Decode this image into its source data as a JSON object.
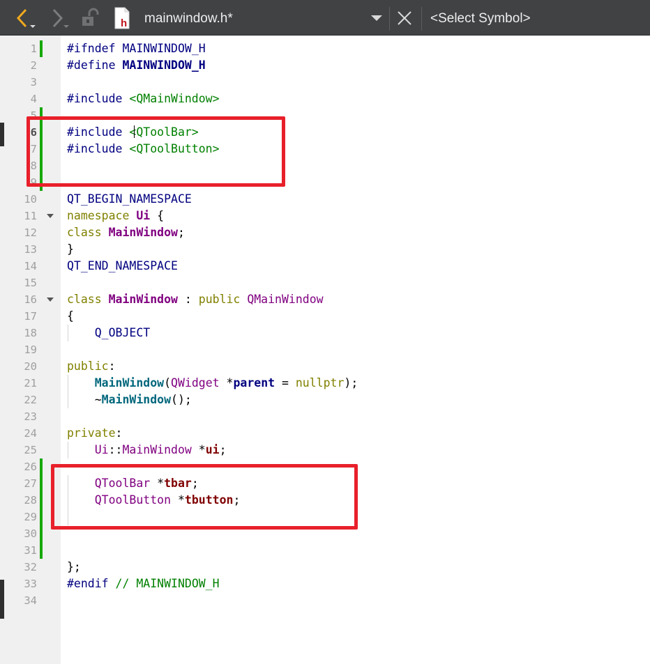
{
  "toolbar": {
    "file_name": "mainwindow.h*",
    "symbol_selector": "<Select Symbol>"
  },
  "editor": {
    "current_line": 6,
    "lines": [
      {
        "n": "1",
        "tokens": [
          [
            "pp",
            "#ifndef "
          ],
          [
            "mac",
            "MAINWINDOW_H"
          ]
        ]
      },
      {
        "n": "2",
        "tokens": [
          [
            "pp",
            "#define "
          ],
          [
            "param",
            "MAINWINDOW_H"
          ]
        ]
      },
      {
        "n": "3",
        "tokens": []
      },
      {
        "n": "4",
        "tokens": [
          [
            "pp",
            "#include "
          ],
          [
            "inc",
            "<QMainWindow>"
          ]
        ]
      },
      {
        "n": "5",
        "tokens": []
      },
      {
        "n": "6",
        "tokens": [
          [
            "pp",
            "#include "
          ],
          [
            "inc",
            "<QToolBar>"
          ]
        ]
      },
      {
        "n": "7",
        "tokens": [
          [
            "pp",
            "#include "
          ],
          [
            "inc",
            "<QToolButton>"
          ]
        ]
      },
      {
        "n": "8",
        "tokens": []
      },
      {
        "n": "9",
        "tokens": []
      },
      {
        "n": "10",
        "tokens": [
          [
            "mac",
            "QT_BEGIN_NAMESPACE"
          ]
        ]
      },
      {
        "n": "11",
        "fold": true,
        "tokens": [
          [
            "kw",
            "namespace "
          ],
          [
            "typeb",
            "Ui"
          ],
          [
            "plain",
            " {"
          ]
        ]
      },
      {
        "n": "12",
        "tokens": [
          [
            "kw",
            "class "
          ],
          [
            "typeb",
            "MainWindow"
          ],
          [
            "plain",
            ";"
          ]
        ]
      },
      {
        "n": "13",
        "tokens": [
          [
            "plain",
            "}"
          ]
        ]
      },
      {
        "n": "14",
        "tokens": [
          [
            "mac",
            "QT_END_NAMESPACE"
          ]
        ]
      },
      {
        "n": "15",
        "tokens": []
      },
      {
        "n": "16",
        "fold": true,
        "tokens": [
          [
            "kw",
            "class "
          ],
          [
            "typeb",
            "MainWindow"
          ],
          [
            "plain",
            " : "
          ],
          [
            "kw",
            "public "
          ],
          [
            "type",
            "QMainWindow"
          ]
        ]
      },
      {
        "n": "17",
        "tokens": [
          [
            "plain",
            "{"
          ]
        ]
      },
      {
        "n": "18",
        "tokens": [
          [
            "plain",
            "    "
          ],
          [
            "mac",
            "Q_OBJECT"
          ]
        ]
      },
      {
        "n": "19",
        "tokens": []
      },
      {
        "n": "20",
        "tokens": [
          [
            "kw",
            "public"
          ],
          [
            "plain",
            ":"
          ]
        ]
      },
      {
        "n": "21",
        "tokens": [
          [
            "plain",
            "    "
          ],
          [
            "fn",
            "MainWindow"
          ],
          [
            "plain",
            "("
          ],
          [
            "type",
            "QWidget"
          ],
          [
            "plain",
            " *"
          ],
          [
            "param",
            "parent"
          ],
          [
            "plain",
            " = "
          ],
          [
            "kw",
            "nullptr"
          ],
          [
            "plain",
            ");"
          ]
        ]
      },
      {
        "n": "22",
        "tokens": [
          [
            "plain",
            "    ~"
          ],
          [
            "fn",
            "MainWindow"
          ],
          [
            "plain",
            "();"
          ]
        ]
      },
      {
        "n": "23",
        "tokens": []
      },
      {
        "n": "24",
        "tokens": [
          [
            "kw",
            "private"
          ],
          [
            "plain",
            ":"
          ]
        ]
      },
      {
        "n": "25",
        "tokens": [
          [
            "plain",
            "    "
          ],
          [
            "ns",
            "Ui"
          ],
          [
            "plain",
            "::"
          ],
          [
            "type",
            "MainWindow"
          ],
          [
            "plain",
            " *"
          ],
          [
            "mem",
            "ui"
          ],
          [
            "plain",
            ";"
          ]
        ]
      },
      {
        "n": "26",
        "tokens": []
      },
      {
        "n": "27",
        "tokens": [
          [
            "plain",
            "    "
          ],
          [
            "type",
            "QToolBar"
          ],
          [
            "plain",
            " *"
          ],
          [
            "mem",
            "tbar"
          ],
          [
            "plain",
            ";"
          ]
        ]
      },
      {
        "n": "28",
        "tokens": [
          [
            "plain",
            "    "
          ],
          [
            "type",
            "QToolButton"
          ],
          [
            "plain",
            " *"
          ],
          [
            "mem",
            "tbutton"
          ],
          [
            "plain",
            ";"
          ]
        ]
      },
      {
        "n": "29",
        "tokens": []
      },
      {
        "n": "30",
        "tokens": []
      },
      {
        "n": "31",
        "tokens": []
      },
      {
        "n": "32",
        "tokens": [
          [
            "plain",
            "};"
          ]
        ]
      },
      {
        "n": "33",
        "tokens": [
          [
            "pp",
            "#endif "
          ],
          [
            "cmt",
            "// MAINWINDOW_H"
          ]
        ]
      },
      {
        "n": "34",
        "tokens": []
      }
    ]
  },
  "icons": {
    "back": "back-arrow-icon",
    "forward": "forward-arrow-icon",
    "lock": "unlock-icon",
    "file_type": "header-file-icon",
    "dropdown": "dropdown-arrow-icon",
    "close": "close-icon"
  },
  "colors": {
    "toolbar_bg": "#404244",
    "back_arrow": "#f0a91e",
    "change_marker": "#17a80a",
    "annotation_box": "#e8202a"
  }
}
